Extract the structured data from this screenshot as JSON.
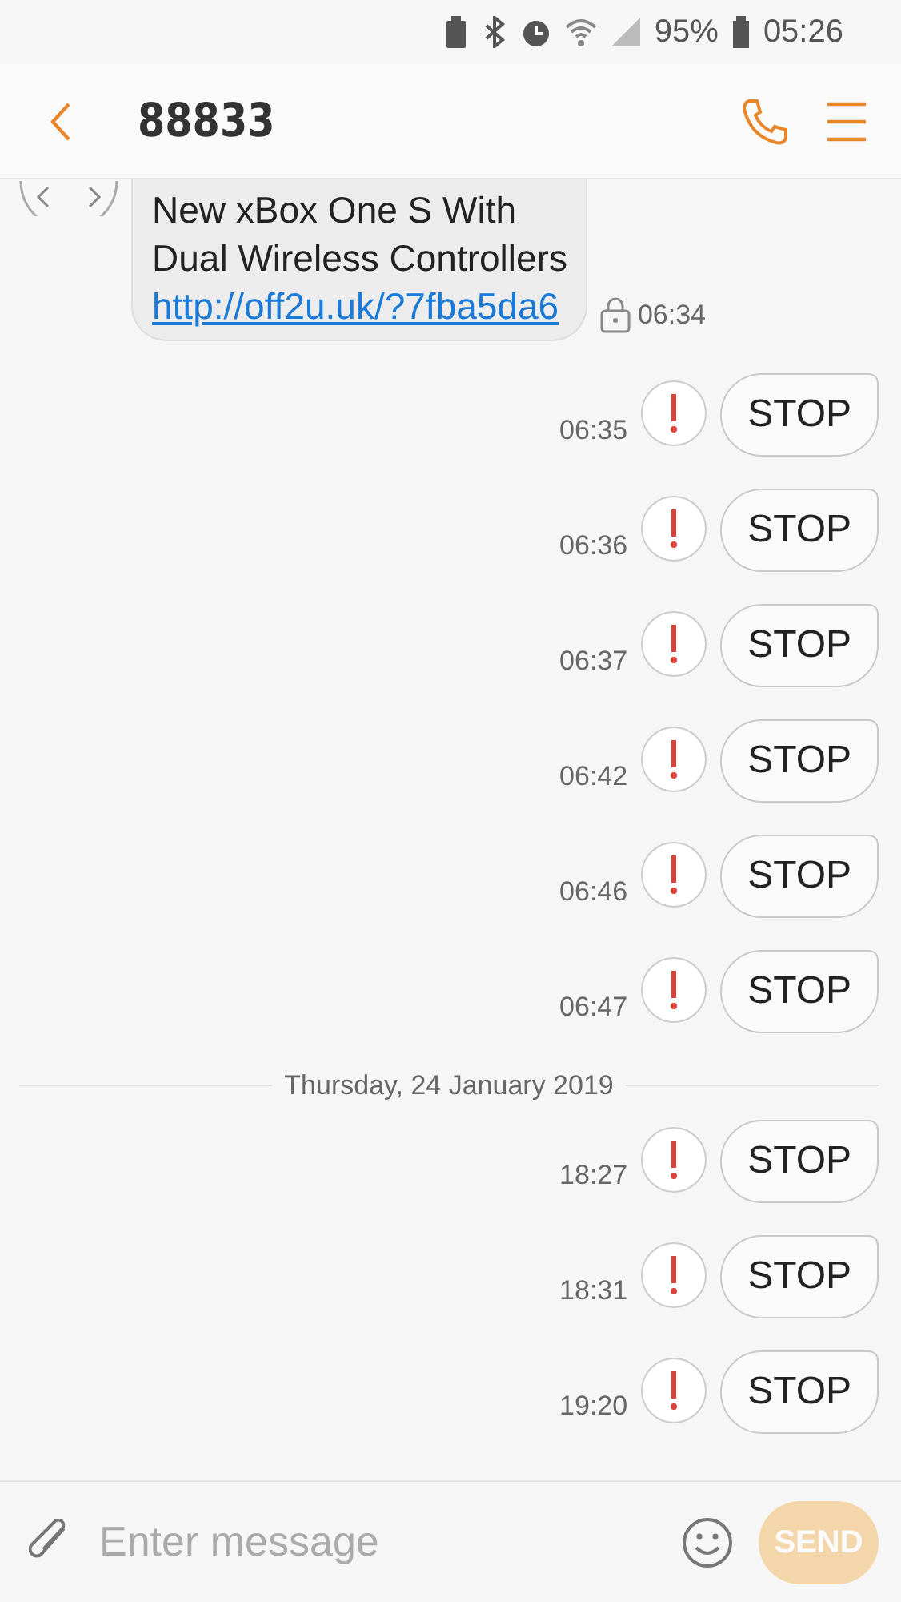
{
  "status_bar": {
    "battery": "95%",
    "time": "05:26"
  },
  "header": {
    "title": "88833"
  },
  "messages": [
    {
      "kind": "incoming",
      "lines": [
        "New xBox One S With",
        "Dual Wireless Controllers"
      ],
      "link": "http://off2u.uk/?7fba5da6",
      "time": "06:34",
      "locked": true
    },
    {
      "kind": "outgoing",
      "text": "STOP",
      "time": "06:35",
      "failed": true
    },
    {
      "kind": "outgoing",
      "text": "STOP",
      "time": "06:36",
      "failed": true
    },
    {
      "kind": "outgoing",
      "text": "STOP",
      "time": "06:37",
      "failed": true
    },
    {
      "kind": "outgoing",
      "text": "STOP",
      "time": "06:42",
      "failed": true
    },
    {
      "kind": "outgoing",
      "text": "STOP",
      "time": "06:46",
      "failed": true
    },
    {
      "kind": "outgoing",
      "text": "STOP",
      "time": "06:47",
      "failed": true
    },
    {
      "kind": "date",
      "text": "Thursday, 24 January 2019"
    },
    {
      "kind": "outgoing",
      "text": "STOP",
      "time": "18:27",
      "failed": true
    },
    {
      "kind": "outgoing",
      "text": "STOP",
      "time": "18:31",
      "failed": true
    },
    {
      "kind": "outgoing",
      "text": "STOP",
      "time": "19:20",
      "failed": true
    }
  ],
  "composer": {
    "placeholder": "Enter message",
    "send": "SEND",
    "send_disabled": true
  }
}
